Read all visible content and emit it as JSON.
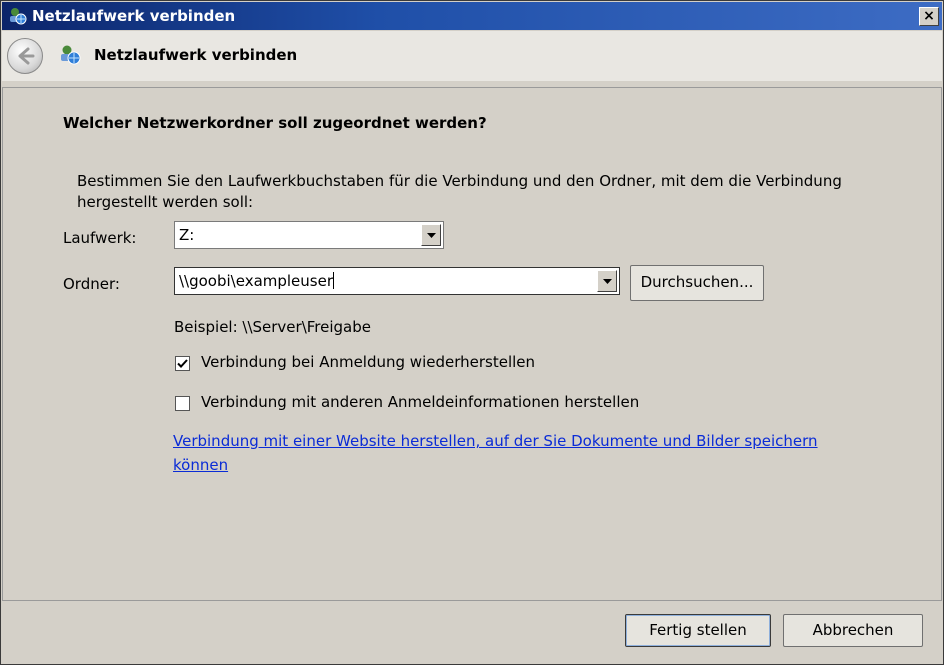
{
  "window": {
    "title": "Netzlaufwerk verbinden",
    "close_symbol": "×"
  },
  "nav": {
    "title": "Netzlaufwerk verbinden"
  },
  "content": {
    "heading": "Welcher Netzwerkordner soll zugeordnet werden?",
    "description": "Bestimmen Sie den Laufwerkbuchstaben für die Verbindung und den Ordner, mit dem die Verbindung hergestellt werden soll:",
    "drive_label": "Laufwerk:",
    "drive_value": "Z:",
    "folder_label": "Ordner:",
    "folder_value": "\\\\goobi\\exampleuser",
    "browse_label": "Durchsuchen...",
    "example_text": "Beispiel: \\\\Server\\Freigabe",
    "reconnect_label": "Verbindung bei Anmeldung wiederherstellen",
    "reconnect_checked": true,
    "other_credentials_label": "Verbindung mit anderen Anmeldeinformationen herstellen",
    "other_credentials_checked": false,
    "website_link": "Verbindung mit einer Website herstellen, auf der Sie Dokumente und Bilder speichern können"
  },
  "footer": {
    "finish_label": "Fertig stellen",
    "cancel_label": "Abbrechen"
  }
}
